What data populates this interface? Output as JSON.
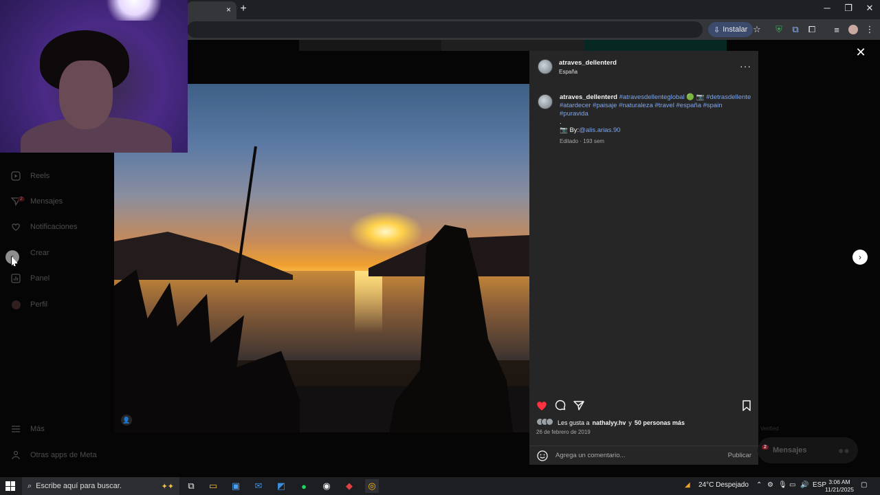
{
  "browser": {
    "tab_close": "×",
    "new_tab": "+",
    "install_label": "Instalar",
    "window_controls": [
      "─",
      "❐",
      "✕"
    ]
  },
  "sidebar": {
    "items": [
      {
        "label": "Reels",
        "icon": "reels-icon"
      },
      {
        "label": "Mensajes",
        "icon": "messages-icon",
        "badge": "2"
      },
      {
        "label": "Notificaciones",
        "icon": "heart-icon"
      },
      {
        "label": "Crear",
        "icon": "plus-icon"
      },
      {
        "label": "Panel",
        "icon": "chart-icon"
      },
      {
        "label": "Perfil",
        "icon": "profile-icon"
      }
    ],
    "more_label": "Más",
    "meta_apps_label": "Otras apps de Meta"
  },
  "post": {
    "username": "atraves_dellenterd",
    "location": "España",
    "caption_user": "atraves_dellenterd",
    "caption_line1": "#atravesdellenteglobal",
    "caption_emoji": "🟢 📷",
    "caption_tag2": "#detrasdellente",
    "caption_tags": "#atardecer #paisaje #naturaleza #travel #españa #spain #puravida",
    "caption_dot": ".",
    "caption_by_prefix": "📷 By:",
    "caption_by_handle": "@alis.arias.90",
    "caption_meta": "Editado · 193 sem",
    "likes_text_prefix": "Les gusta a",
    "likes_user": "nathalyy.hv",
    "likes_text_mid": "y",
    "likes_others": "50 personas más",
    "date": "26 de febrero de 2019",
    "comment_placeholder": "Agrega un comentario...",
    "publish_label": "Publicar",
    "liked": true
  },
  "floating_messages": {
    "label": "Mensajes",
    "badge": "2",
    "verified": "Verified"
  },
  "taskbar": {
    "search_placeholder": "Escribe aquí para buscar.",
    "weather": "24°C  Despejado",
    "language": "ESP",
    "time": "3:06 AM",
    "date": "11/21/2025"
  },
  "colors": {
    "accent_blue": "#7fa6ea",
    "like_red": "#ff3040",
    "panel_bg": "#262626"
  }
}
